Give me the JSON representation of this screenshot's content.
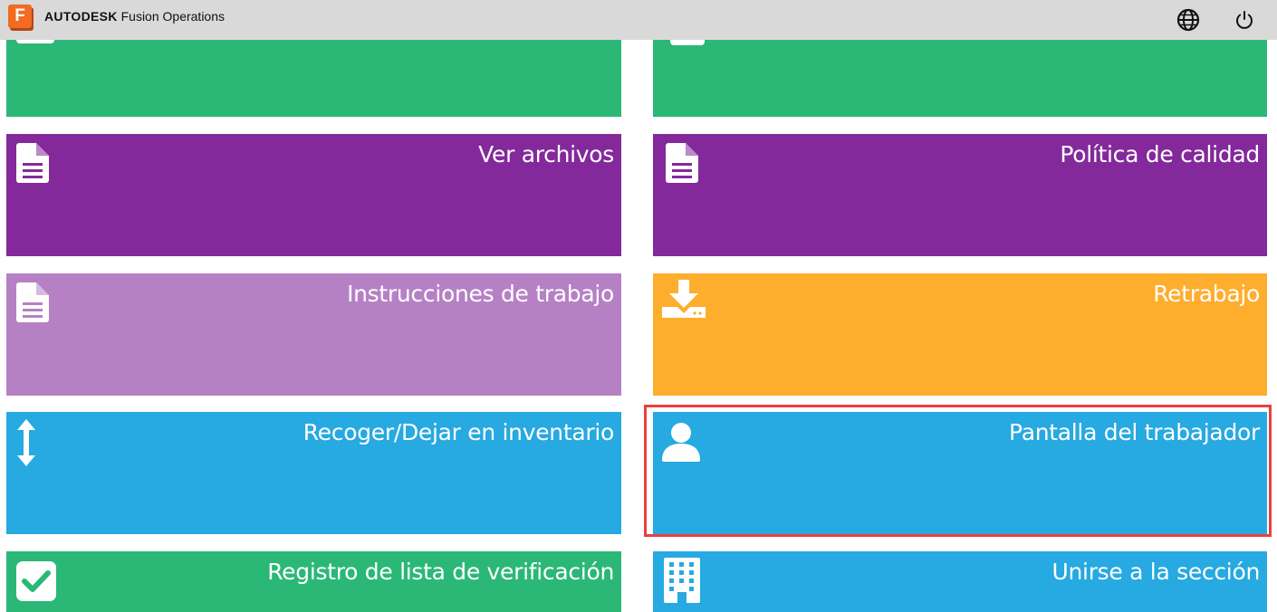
{
  "header": {
    "brand_strong": "AUTODESK",
    "brand_product": "Fusion Operations",
    "logo_letter": "F",
    "logo_color": "#f26b21",
    "icons": [
      "globe-icon",
      "power-icon"
    ]
  },
  "tiles": {
    "top_left": {
      "label": "",
      "color": "#2bb877"
    },
    "top_right": {
      "label": "",
      "color": "#2bb877"
    },
    "ver_archivos": {
      "label": "Ver archivos",
      "icon": "file-icon",
      "color": "#84299b"
    },
    "politica_calidad": {
      "label": "Política de calidad",
      "icon": "file-icon",
      "color": "#84299b"
    },
    "instrucciones": {
      "label": "Instrucciones de trabajo",
      "icon": "file-icon",
      "color": "#b681c4"
    },
    "retrabajo": {
      "label": "Retrabajo",
      "icon": "download-tray-icon",
      "color": "#ffad2d"
    },
    "recoger": {
      "label": "Recoger/Dejar en inventario",
      "icon": "vertical-arrows-icon",
      "color": "#27a9e1"
    },
    "pantalla_trabajador": {
      "label": "Pantalla del trabajador",
      "icon": "user-icon",
      "color": "#27a9e1",
      "highlighted": true
    },
    "registro_lista": {
      "label": "Registro de lista de verificación",
      "icon": "checkbox-icon",
      "color": "#2bb877"
    },
    "unirse_seccion": {
      "label": "Unirse a la sección",
      "icon": "building-icon",
      "color": "#27a9e1"
    }
  },
  "highlight_color": "#e8413c"
}
